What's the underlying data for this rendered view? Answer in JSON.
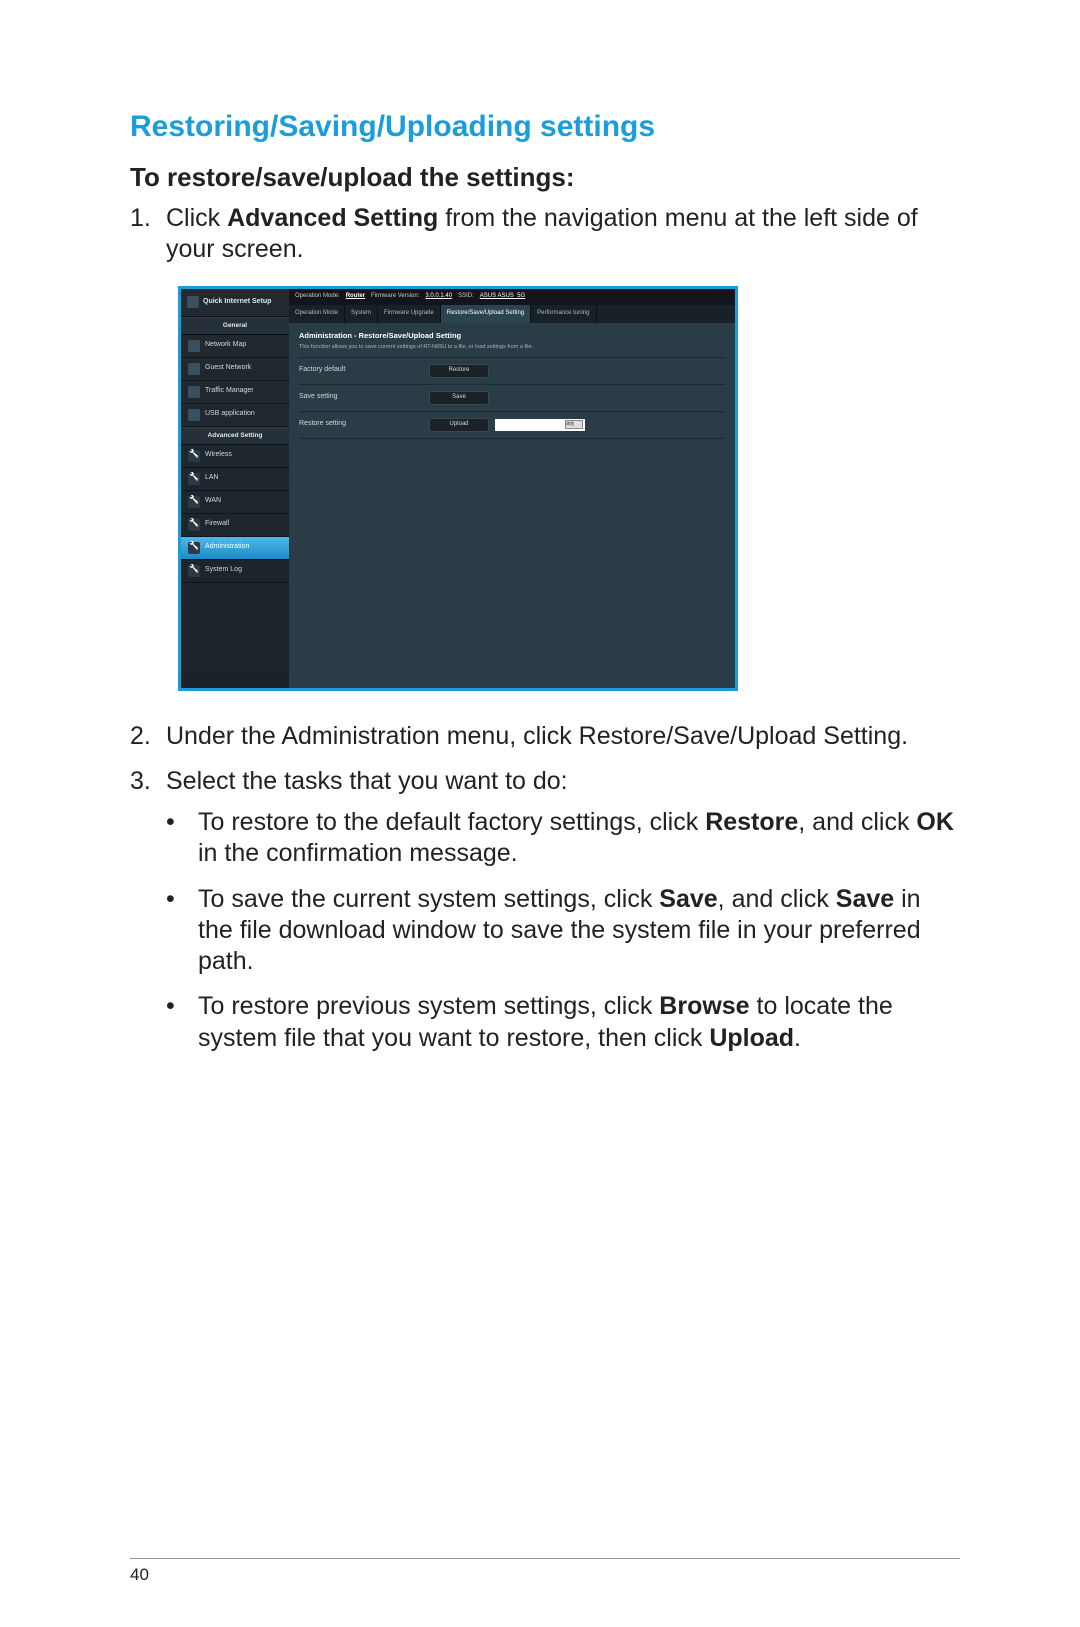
{
  "heading": "Restoring/Saving/Uploading settings",
  "subheading": "To restore/save/upload the settings:",
  "step1": {
    "pre": "Click ",
    "bold": "Advanced Setting",
    "post": " from the navigation menu at the left side of your screen."
  },
  "step2": "Under the Administration menu, click Restore/Save/Upload Setting.",
  "step3": {
    "intro": "Select the tasks that you want to do:",
    "bullets": [
      {
        "t1": "To restore to the default factory settings, click ",
        "b1": "Restore",
        "t2": ", and click ",
        "b2": "OK",
        "t3": " in the confirmation message."
      },
      {
        "t1": "To save the current system settings, click ",
        "b1": "Save",
        "t2": ", and click ",
        "b2": "Save",
        "t3": " in the file download window to save the system file in your preferred path."
      },
      {
        "t1": "To restore previous system settings, click ",
        "b1": "Browse",
        "t2": " to locate the system file that you want to restore, then click ",
        "b2": "Upload",
        "t3": "."
      }
    ]
  },
  "screenshot": {
    "qis": "Quick Internet Setup",
    "section_general": "General",
    "nav_general": [
      "Network Map",
      "Guest Network",
      "Traffic Manager",
      "USB application"
    ],
    "section_advanced": "Advanced Setting",
    "nav_advanced": [
      "Wireless",
      "LAN",
      "WAN",
      "Firewall",
      "Administration",
      "System Log"
    ],
    "nav_active": "Administration",
    "topbar": {
      "mode_lbl": "Operation Mode:",
      "mode_val": "Router",
      "fw_lbl": "Firmware Version:",
      "fw_val": "3.0.0.1.40",
      "ssid_lbl": "SSID:",
      "ssid_val": "ASUS  ASUS_5G"
    },
    "tabs": [
      "Operation Mode",
      "System",
      "Firmware Upgrade",
      "Restore/Save/Upload Setting",
      "Performance tuning"
    ],
    "tab_active": "Restore/Save/Upload Setting",
    "panel_title": "Administration - Restore/Save/Upload Setting",
    "panel_desc": "This function allows you to save current settings of RT-N65U to a file, or load settings from a file.",
    "rows": [
      {
        "label": "Factory default",
        "btn": "Restore"
      },
      {
        "label": "Save setting",
        "btn": "Save"
      },
      {
        "label": "Restore setting",
        "btn": "Upload",
        "file": true,
        "browse": "浏览"
      }
    ]
  },
  "page_number": "40"
}
